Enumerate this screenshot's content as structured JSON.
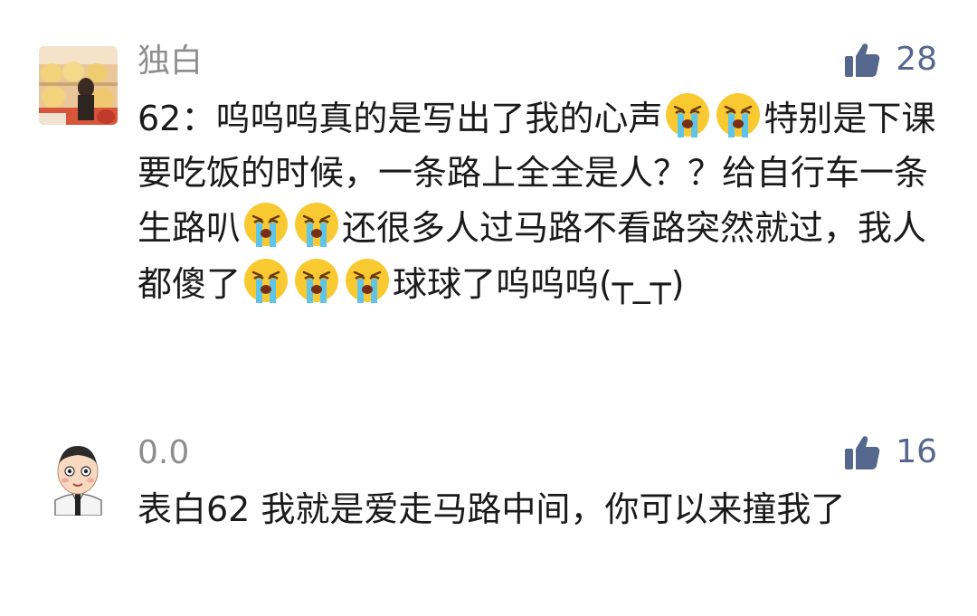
{
  "comments": [
    {
      "author": "独白",
      "likes": "28",
      "text_parts": [
        "62：呜呜呜真的是写出了我的心声",
        "特别是下课要吃饭的时候，一条路上全全是人？？给自行车一条生路叭",
        "还很多人过马路不看路突然就过，我人都傻了",
        "球球了呜呜呜(┬_┬)"
      ],
      "emoji": "loudly-crying-face-icon"
    },
    {
      "author": "0.0",
      "likes": "16",
      "text": "表白62 我就是爱走马路中间，你可以来撞我了"
    }
  ],
  "colors": {
    "author": "#8e8e8e",
    "like": "#55678d",
    "text": "#1a1a1a"
  }
}
